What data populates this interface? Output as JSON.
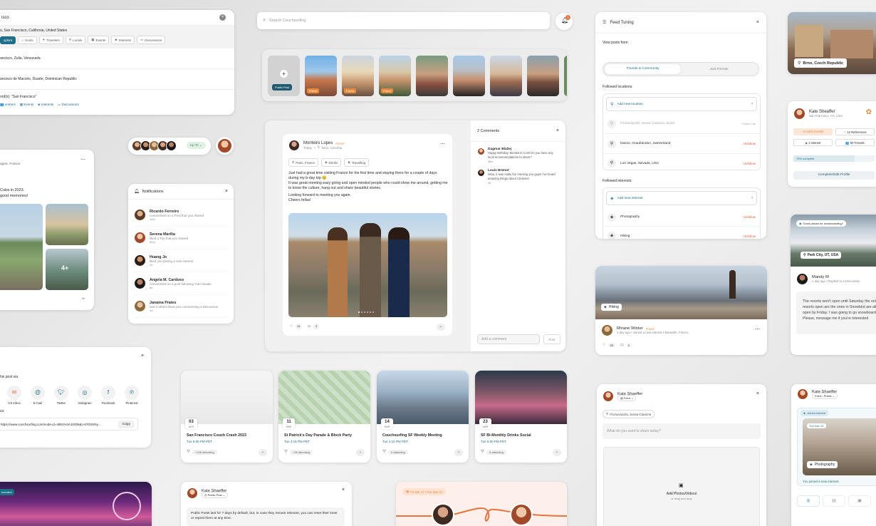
{
  "search": {
    "query": "isco",
    "results": [
      {
        "title": "o, San Francisco, California, United States"
      },
      {
        "title": "ancisco, Zulia, Venezuela"
      },
      {
        "title": "ancisco de Macoris, Duarte, Dominican Republic"
      },
      {
        "title": "ord(s): \"San Francisco\""
      }
    ],
    "filters1": [
      "xplore",
      "Hosts",
      "Travelers",
      "Locals",
      "Events",
      "Interests",
      "Discussions"
    ],
    "filters2": [
      "embers",
      "Events",
      "Interests",
      "Discussions"
    ]
  },
  "topsearch": {
    "placeholder": "Search Couchsurfing",
    "notif_count": "3"
  },
  "stories": {
    "public_label": "Public Post",
    "badges": [
      "Friend",
      "Friend",
      "Friend"
    ]
  },
  "feed_tuning": {
    "title": "Feed Tuning",
    "view_label": "View posts from:",
    "options": [
      "Friends & Community",
      "Just Friends"
    ],
    "locations_label": "Followed locations:",
    "add_location": "Add new location",
    "locations": [
      {
        "name": "Florianópolis, Santa Catarina, Brazil",
        "action": "Follow City",
        "muted": true
      },
      {
        "name": "Davos, Graubünden, Switzerland",
        "action": "Unfollow"
      },
      {
        "name": "Los Vegas, Nevada, USA",
        "action": "Unfollow"
      }
    ],
    "interests_label": "Followed interests:",
    "add_interest": "Add new interest",
    "interests": [
      {
        "name": "Photography",
        "action": "Unfollow"
      },
      {
        "name": "Hiking",
        "action": "Unfollow"
      }
    ]
  },
  "brno": {
    "location": "Brno, Czech Republic"
  },
  "profile": {
    "name": "Kate Sheaffer",
    "location": "San Francisco, CA, USA",
    "accepts": "Accepts Guests",
    "references": "13 References",
    "interests": "1 Interest",
    "friends": "50 Friends",
    "progress_label": "75% complete",
    "progress": 0.75,
    "cta": "Complete/Edit Profile"
  },
  "post_main": {
    "author": "Monteiro Lopes",
    "badge": "Friend",
    "when": "Today",
    "where": "Brno, Czechia",
    "tags": [
      "Paris, France",
      "Drinks",
      "Travelling"
    ],
    "body1": "Just had a great time visiting France for the first time and staying there for a couple of days during my b-day trip 😊",
    "body2": "It was great meeting easy going and open minded people who could show me around, getting me to know the culture, hang out and share beautiful stories.",
    "body3": "Looking forward to meeting you again.",
    "body4": "Cheers fellas!",
    "likes": "11",
    "comments": "2"
  },
  "comments": {
    "title": "2 Comments",
    "items": [
      {
        "name": "Dagmar Blažej",
        "text": "Happy Birthday, Monteiro! Cool! Do you have any local recommendations to share?",
        "meta": "48m"
      },
      {
        "name": "Louis Brenot",
        "text": "Wow, it was really fun meeting you guys! I've heard amazing things about Cholena!",
        "meta": "2h"
      }
    ],
    "placeholder": "Add a comment",
    "post": "Post"
  },
  "notifications": {
    "title": "Notifications",
    "items": [
      {
        "name": "Ricardo Ferreiro",
        "text": "commented on a Post that you shared",
        "time": "16m"
      },
      {
        "name": "Serena Marilia",
        "text": "liked a Trip that you shared",
        "time": "52m"
      },
      {
        "name": "Huang Jo",
        "text": "liked you joining a new interest",
        "time": "2h"
      },
      {
        "name": "Angela M. Cardoso",
        "text": "commented on a post following Yuki Sasaki",
        "time": "8h"
      },
      {
        "name": "Janaina Prates",
        "text": "and 4 others liked you commenting a Discussion",
        "time": "1d"
      }
    ]
  },
  "upto": {
    "label": "Up To"
  },
  "left_post": {
    "location": "agne, France",
    "text1": "Cuba in 2023.",
    "text2": "good memories!",
    "more": "4+"
  },
  "share": {
    "title": "his post via",
    "targets": [
      "CS inbox",
      "E-mail",
      "Twitter",
      "Instagram",
      "Facebook",
      "Pinterest"
    ],
    "link_label": "ink",
    "link": "https://www.couchsurfing.com/node-id=4991%3A10306&t=57iD0X6y...",
    "copy": "Copy"
  },
  "events": [
    {
      "day": "03",
      "mon": "AUG",
      "title": "San Francisco Couch Crash 2023",
      "time": "Tue 6:00 PM PDT",
      "attending": "+106 attending"
    },
    {
      "day": "11",
      "mon": "MAR",
      "title": "St Patrick's Day Parade & Block Party",
      "time": "Tue 4:15 PM PDT",
      "attending": "+36 attending"
    },
    {
      "day": "14",
      "mon": "MAR",
      "title": "Couchsurfing SF Weekly Meeting",
      "time": "Tue 4:15 PM PDT",
      "attending": "0 attending"
    },
    {
      "day": "23",
      "mon": "MAR",
      "title": "SF Bi-Monthly Drinks Social",
      "time": "Tue 6:00 PM PDT",
      "attending": "0 attending"
    }
  ],
  "hiking": {
    "tag": "Hiking",
    "author": "Rhiane Winter",
    "badge": "Friend",
    "meta": "1 day ago • Joined a new Interest • Marseille, France",
    "likes": "23",
    "comments": "2"
  },
  "park": {
    "question": "Good places for snowboarding?",
    "location": "Park City, UT, USA",
    "author": "Mandy M",
    "meta": "1 day ago • Replied to a Discussion",
    "text": "The resorts won't open until Saturday the only resorts open are the ones in Snowbird are all open by Friday. I was going to go snowboarding Please, message me if you're interested"
  },
  "compose": {
    "author": "Kate Shaeffer",
    "audience": "Feed",
    "location": "Florianópolis, Santa Catarina",
    "placeholder": "What do you want to share today?",
    "add_media": "Add Photos/Videos",
    "drop": "or drag and drop"
  },
  "joined": {
    "author": "Kate Shaeffer",
    "audience": "Feed • Public",
    "badge": "Joined Interest",
    "date": "Tue Nov 22",
    "tag": "Photography",
    "footer": "You joined a new interest."
  },
  "bottom_post": {
    "author": "Kate Shaeffer",
    "audience": "Public Post",
    "text": "Public Posts last for 7 days by default, but, in case they remain relevant, you can reset their timer or repost them at any time."
  },
  "trip": {
    "dates": "Fri Mar 17 • Tue Mar 21"
  },
  "festival": {
    "badge": "mended"
  }
}
